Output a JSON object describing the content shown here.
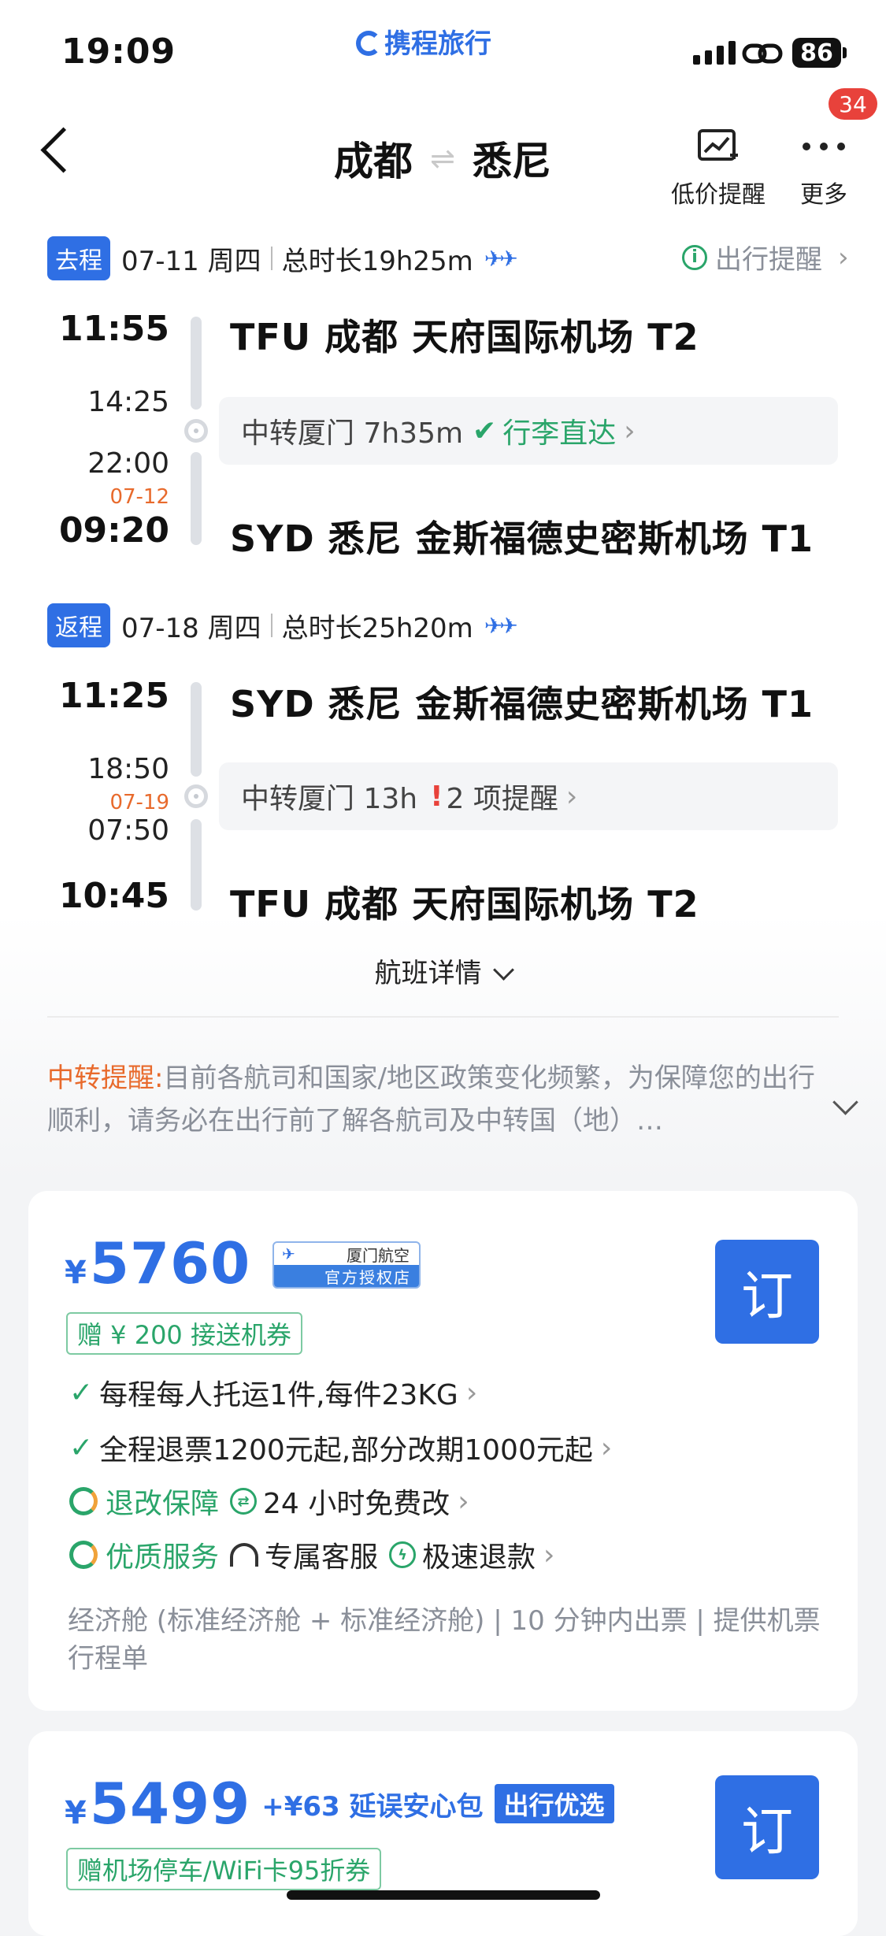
{
  "status_bar": {
    "time": "19:09",
    "brand": "携程旅行",
    "battery": "86"
  },
  "header": {
    "origin": "成都",
    "swap_icon": "⇌",
    "destination": "悉尼",
    "price_alert_label": "低价提醒",
    "more_label": "更多",
    "notification_count": "34"
  },
  "outbound": {
    "tag": "去程",
    "date": "07-11 周四",
    "duration": "总时长19h25m",
    "trip_reminder": "出行提醒",
    "dep_time": "11:55",
    "dep_airport": "TFU  成都 天府国际机场 T2",
    "transfer_arrive": "14:25",
    "transfer_depart": "22:00",
    "arr_date_change": "07-12",
    "transfer_text": "中转厦门 7h35m",
    "transfer_note": "行李直达",
    "arr_time": "09:20",
    "arr_airport": "SYD  悉尼 金斯福德史密斯机场 T1"
  },
  "return": {
    "tag": "返程",
    "date": "07-18 周四",
    "duration": "总时长25h20m",
    "dep_time": "11:25",
    "dep_airport": "SYD  悉尼 金斯福德史密斯机场 T1",
    "transfer_arrive": "18:50",
    "transfer_date_change": "07-19",
    "transfer_depart": "07:50",
    "transfer_text": "中转厦门 13h",
    "transfer_note": "2 项提醒",
    "arr_time": "10:45",
    "arr_airport": "TFU  成都 天府国际机场 T2"
  },
  "details_link": "航班详情",
  "notice": {
    "label": "中转提醒:",
    "text": "目前各航司和国家/地区政策变化频繁，为保障您的出行顺利，请务必在出行前了解各航司及中转国（地）…"
  },
  "offer1": {
    "currency": "¥",
    "price": "5760",
    "airline_name": "厦门航空",
    "airline_store": "官方授权店",
    "gift": "赠 ¥ 200 接送机券",
    "book_label": "订",
    "baggage": "每程每人托运1件,每件23KG",
    "refund": "全程退票1200元起,部分改期1000元起",
    "guarantee_label": "退改保障",
    "guarantee_text": "24 小时免费改",
    "service_label": "优质服务",
    "service_support": "专属客服",
    "service_refund": "极速退款",
    "meta": "经济舱 (标准经济舱 + 标准经济舱) | 10 分钟内出票 | 提供机票行程单"
  },
  "offer2": {
    "currency": "¥",
    "price": "5499",
    "insurance": "+¥63 延误安心包",
    "badge": "出行优选",
    "gift": "赠机场停车/WiFi卡95折券",
    "book_label": "订"
  },
  "colors": {
    "accent": "#2f6fe4",
    "green": "#2aa56a",
    "orange": "#e86a2c",
    "red": "#e8423b"
  }
}
